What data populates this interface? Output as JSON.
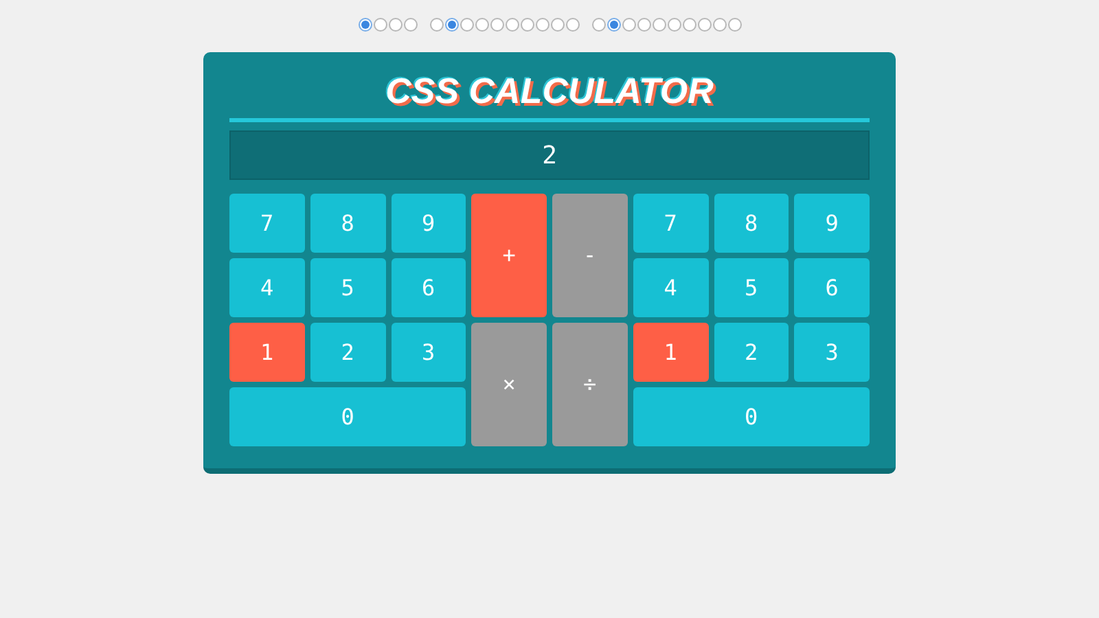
{
  "radio_groups": [
    {
      "radios": [
        {
          "selected": true
        },
        {
          "selected": false
        },
        {
          "selected": false
        },
        {
          "selected": false
        }
      ]
    },
    {
      "radios": [
        {
          "selected": false
        },
        {
          "selected": true
        },
        {
          "selected": false
        },
        {
          "selected": false
        },
        {
          "selected": false
        },
        {
          "selected": false
        },
        {
          "selected": false
        },
        {
          "selected": false
        },
        {
          "selected": false
        },
        {
          "selected": false
        }
      ]
    },
    {
      "radios": [
        {
          "selected": false
        },
        {
          "selected": true
        },
        {
          "selected": false
        },
        {
          "selected": false
        },
        {
          "selected": false
        },
        {
          "selected": false
        },
        {
          "selected": false
        },
        {
          "selected": false
        },
        {
          "selected": false
        },
        {
          "selected": false
        }
      ]
    }
  ],
  "title": "CSS CALCULATOR",
  "display": "2",
  "left_pad": [
    {
      "label": "7",
      "kind": "digit",
      "selected": false
    },
    {
      "label": "8",
      "kind": "digit",
      "selected": false
    },
    {
      "label": "9",
      "kind": "digit",
      "selected": false
    },
    {
      "label": "4",
      "kind": "digit",
      "selected": false
    },
    {
      "label": "5",
      "kind": "digit",
      "selected": false
    },
    {
      "label": "6",
      "kind": "digit",
      "selected": false
    },
    {
      "label": "1",
      "kind": "digit",
      "selected": true
    },
    {
      "label": "2",
      "kind": "digit",
      "selected": false
    },
    {
      "label": "3",
      "kind": "digit",
      "selected": false
    },
    {
      "label": "0",
      "kind": "wide",
      "selected": false
    }
  ],
  "operators": [
    {
      "label": "+",
      "selected": true
    },
    {
      "label": "-",
      "selected": false
    },
    {
      "label": "×",
      "selected": false
    },
    {
      "label": "÷",
      "selected": false
    }
  ],
  "right_pad": [
    {
      "label": "7",
      "kind": "digit",
      "selected": false
    },
    {
      "label": "8",
      "kind": "digit",
      "selected": false
    },
    {
      "label": "9",
      "kind": "digit",
      "selected": false
    },
    {
      "label": "4",
      "kind": "digit",
      "selected": false
    },
    {
      "label": "5",
      "kind": "digit",
      "selected": false
    },
    {
      "label": "6",
      "kind": "digit",
      "selected": false
    },
    {
      "label": "1",
      "kind": "digit",
      "selected": true
    },
    {
      "label": "2",
      "kind": "digit",
      "selected": false
    },
    {
      "label": "3",
      "kind": "digit",
      "selected": false
    },
    {
      "label": "0",
      "kind": "wide",
      "selected": false
    }
  ]
}
